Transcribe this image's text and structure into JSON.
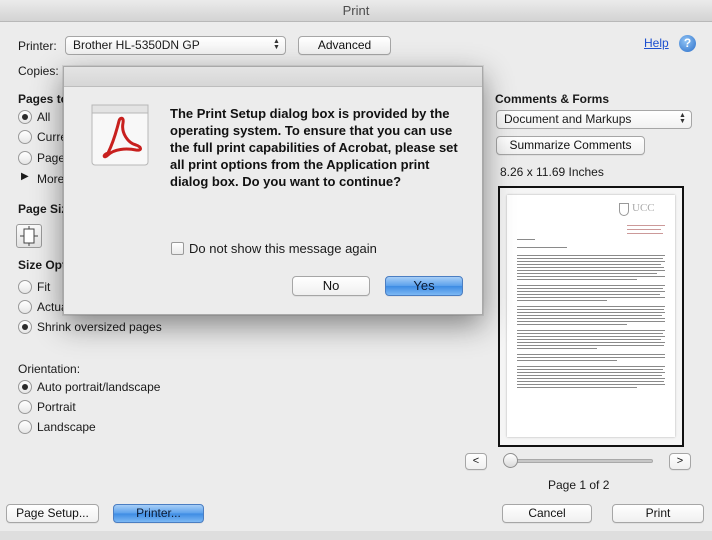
{
  "window": {
    "title": "Print"
  },
  "printer": {
    "label": "Printer:",
    "value": "Brother HL-5350DN GP",
    "advanced_label": "Advanced"
  },
  "help": {
    "link": "Help",
    "icon": "?"
  },
  "copies": {
    "label": "Copies:"
  },
  "pages": {
    "section": "Pages to",
    "options": [
      "All",
      "Curre",
      "Pages",
      "More"
    ]
  },
  "page_size": {
    "section": "Page Siz"
  },
  "size_options": {
    "section": "Size Opt",
    "options": [
      "Fit",
      "Actua",
      "Shrink oversized pages"
    ]
  },
  "orientation": {
    "section": "Orientation:",
    "options": [
      "Auto portrait/landscape",
      "Portrait",
      "Landscape"
    ]
  },
  "comments": {
    "section": "Comments & Forms",
    "value": "Document and Markups",
    "summarize_label": "Summarize Comments",
    "dimensions": "8.26 x 11.69 Inches"
  },
  "preview": {
    "page_indicator": "Page 1 of 2",
    "prev": "<",
    "next": ">",
    "logo_text": "UCC"
  },
  "bottom": {
    "page_setup": "Page Setup...",
    "printer": "Printer...",
    "cancel": "Cancel",
    "print": "Print"
  },
  "dialog": {
    "message": "The Print Setup dialog box is provided by the operating system. To ensure that you can use the full print capabilities of Acrobat, please set all print options from the Application print dialog box. Do you want to continue?",
    "checkbox_label": "Do not show this message again",
    "no_label": "No",
    "yes_label": "Yes"
  }
}
